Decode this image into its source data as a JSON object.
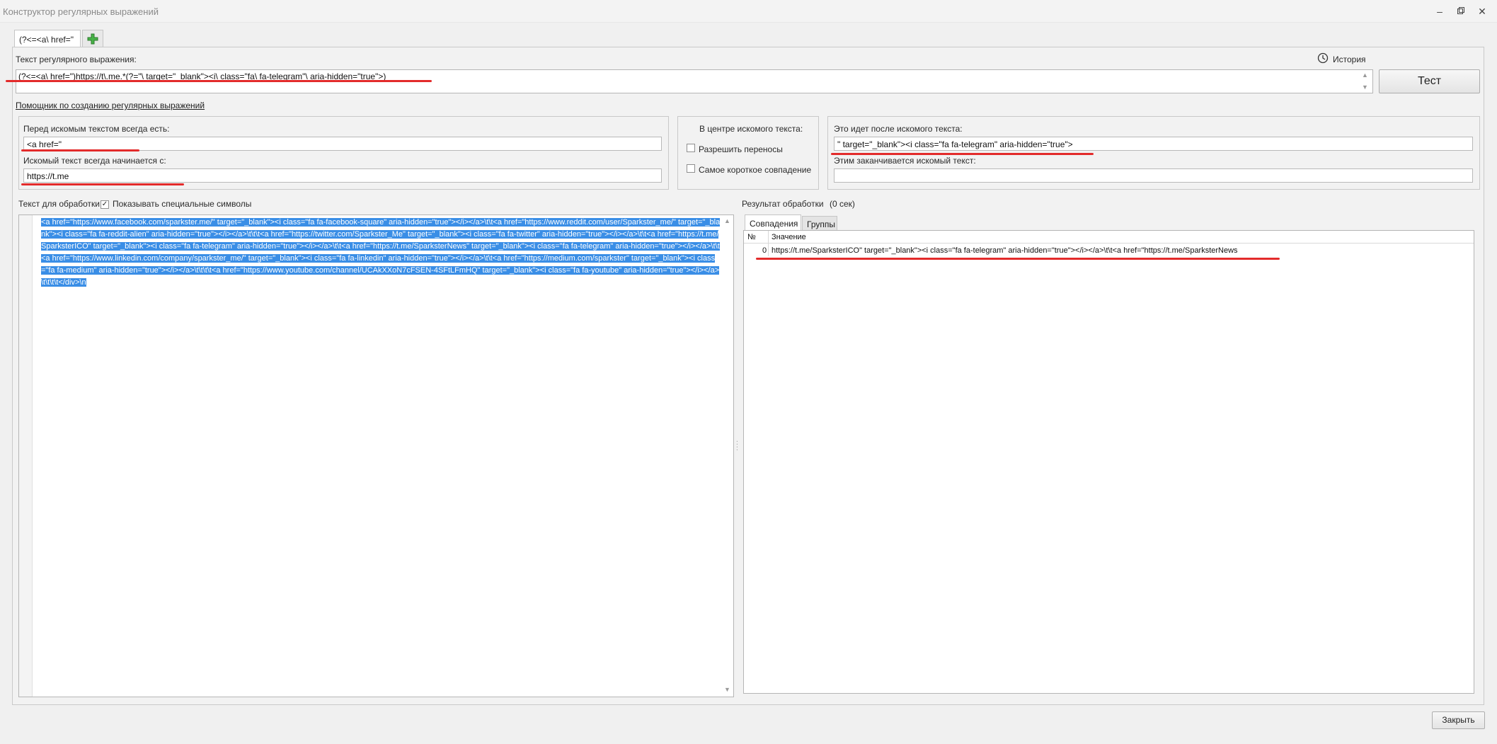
{
  "window": {
    "title": "Конструктор регулярных выражений"
  },
  "tabs": {
    "active_label": "(?<=<a\\ href=\"",
    "add_icon": "plus-icon",
    "add_color": "#3fa83f"
  },
  "regex": {
    "label": "Текст регулярного выражения:",
    "value": "(?<=<a\\ href=\")https://t\\.me.*(?=\"\\ target=\"_blank\"><i\\ class=\"fa\\ fa-telegram\"\\ aria-hidden=\"true\">)",
    "history_label": "История",
    "test_button": "Тест",
    "helper_link": "Помощник по созданию регулярных выражений"
  },
  "helper": {
    "before_label": "Перед искомым текстом всегда есть:",
    "before_value": "<a href=\"",
    "starts_label": "Искомый текст всегда начинается с:",
    "starts_value": "https://t.me",
    "center_label": "В центре искомого текста:",
    "allow_wrap_label": "Разрешить переносы",
    "allow_wrap_checked": false,
    "shortest_label": "Самое короткое совпадение",
    "shortest_checked": false,
    "after_label": "Это идет после искомого текста:",
    "after_value": "\" target=\"_blank\"><i class=\"fa fa-telegram\" aria-hidden=\"true\">",
    "ends_label": "Этим заканчивается искомый текст:",
    "ends_value": ""
  },
  "source": {
    "label": "Текст для обработки",
    "show_special_label": "Показывать специальные символы",
    "show_special_checked": true,
    "text": "<a href=\"https://www.facebook.com/sparkster.me/\" target=\"_blank\"><i class=\"fa fa-facebook-square\" aria-hidden=\"true\"></i></a>\\t\\t<a href=\"https://www.reddit.com/user/Sparkster_me/\" target=\"_blank\"><i class=\"fa fa-reddit-alien\" aria-hidden=\"true\"></i></a>\\t\\t\\t<a href=\"https://twitter.com/Sparkster_Me\" target=\"_blank\"><i class=\"fa fa-twitter\" aria-hidden=\"true\"></i></a>\\t\\t<a href=\"https://t.me/SparksterICO\" target=\"_blank\"><i class=\"fa fa-telegram\" aria-hidden=\"true\"></i></a>\\t\\t<a href=\"https://t.me/SparksterNews\" target=\"_blank\"><i class=\"fa fa-telegram\" aria-hidden=\"true\"></i></a>\\t\\t<a href=\"https://www.linkedin.com/company/sparkster_me/\" target=\"_blank\"><i class=\"fa fa-linkedin\" aria-hidden=\"true\"></i></a>\\t\\t<a href=\"https://medium.com/sparkster\" target=\"_blank\"><i class=\"fa fa-medium\" aria-hidden=\"true\"></i></a>\\t\\t\\t\\t<a href=\"https://www.youtube.com/channel/UCAkXXoN7cFSEN-4SFtLFmHQ\" target=\"_blank\"><i class=\"fa fa-youtube\" aria-hidden=\"true\"></i></a>\\t\\t\\t\\t</div>\\n"
  },
  "result": {
    "label": "Результат обработки",
    "time": "(0 сек)",
    "tab_matches": "Совпадения",
    "tab_groups": "Группы",
    "col_num": "№",
    "col_value": "Значение",
    "rows": [
      {
        "num": "0",
        "value": "https://t.me/SparksterICO\" target=\"_blank\"><i class=\"fa fa-telegram\" aria-hidden=\"true\"></i></a>\\t\\t<a href=\"https://t.me/SparksterNews"
      }
    ]
  },
  "footer": {
    "close_button": "Закрыть"
  },
  "colors": {
    "selection": "#3a8ee6",
    "annotation_red": "#e32b2b"
  }
}
